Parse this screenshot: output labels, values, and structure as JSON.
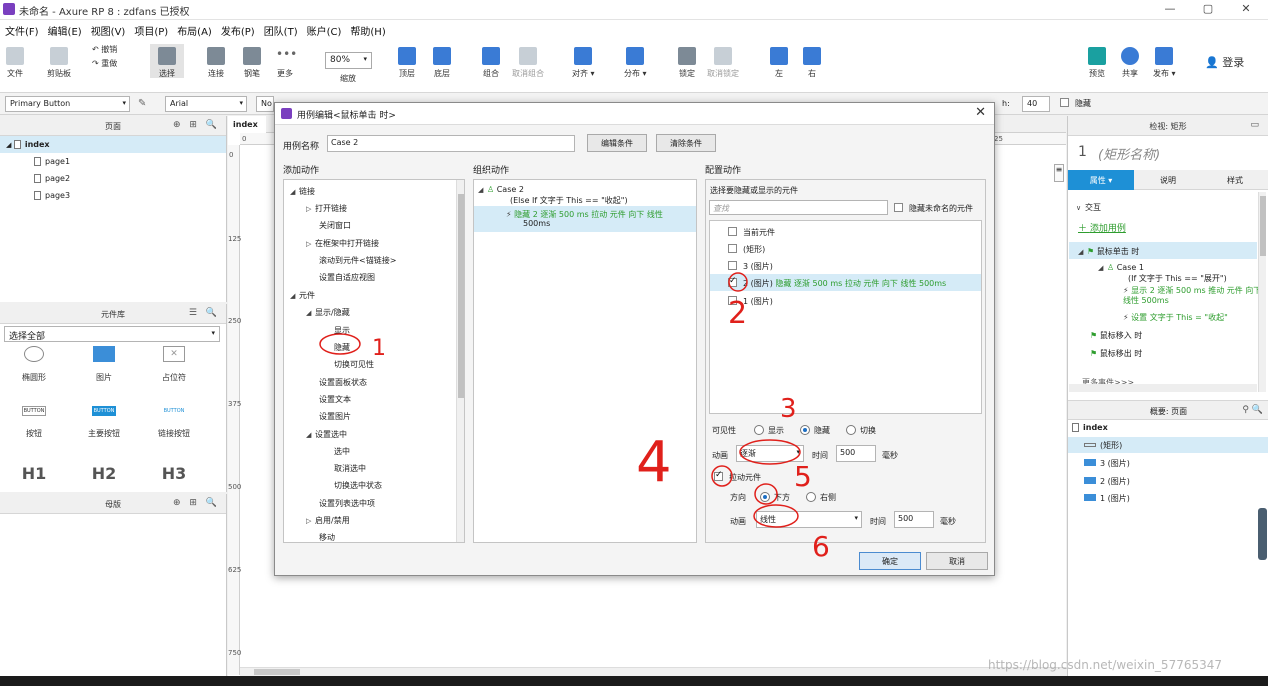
{
  "window": {
    "title": "未命名 - Axure RP 8 : zdfans 已授权"
  },
  "menu": [
    "文件(F)",
    "编辑(E)",
    "视图(V)",
    "项目(P)",
    "布局(A)",
    "发布(P)",
    "团队(T)",
    "账户(C)",
    "帮助(H)"
  ],
  "toolbar": {
    "file": "文件",
    "clipboard": "剪贴板",
    "undo": "撤销",
    "redo": "重做",
    "select": "选择",
    "connect": "连接",
    "pen": "钢笔",
    "more": "更多",
    "zoom_value": "80%",
    "zoom_label": "缩放",
    "top": "顶层",
    "bottom": "底层",
    "group": "组合",
    "ungroup": "取消组合",
    "align": "对齐",
    "distribute": "分布",
    "lock": "锁定",
    "unlock": "取消锁定",
    "left": "左",
    "right": "右",
    "preview": "预览",
    "share": "共享",
    "publish": "发布",
    "login": "登录"
  },
  "format": {
    "style": "Primary Button",
    "font": "Arial",
    "font_style": "No",
    "h_label": "h:",
    "h_value": "40",
    "hidden_label": "隐藏"
  },
  "pages_panel": {
    "title": "页面",
    "items": [
      "index",
      "page1",
      "page2",
      "page3"
    ]
  },
  "library_panel": {
    "title": "元件库",
    "select": "选择全部",
    "widgets": [
      "椭圆形",
      "图片",
      "占位符",
      "按钮",
      "主要按钮",
      "链接按钮",
      "H1",
      "H2",
      "H3"
    ],
    "btn_texts": [
      "BUTTON",
      "BUTTON",
      "BUTTON"
    ]
  },
  "masters_panel": {
    "title": "母版"
  },
  "canvas": {
    "tab": "index",
    "ruler_top": [
      "0",
      "25"
    ],
    "ruler_left": [
      "0",
      "125",
      "250",
      "375",
      "500",
      "625",
      "750"
    ]
  },
  "inspector": {
    "header": "检视: 矩形",
    "number": "1",
    "name": "(矩形名称)",
    "tabs": [
      "属性",
      "说明",
      "样式"
    ],
    "interaction": "交互",
    "add_case": "添加用例",
    "events": [
      {
        "label": "鼠标单击 时"
      },
      {
        "label": "Case 1"
      },
      {
        "label": "(If 文字于 This == \"展开\")"
      },
      {
        "label": "显示 2 逐渐 500 ms 推动 元件 向下 线性 500ms"
      },
      {
        "label": "设置 文字于 This = \"收起\""
      },
      {
        "label": "鼠标移入 时"
      },
      {
        "label": "鼠标移出 时"
      }
    ],
    "more_events": "更多事件>>>"
  },
  "outline": {
    "title": "概要: 页面",
    "items": [
      "index",
      "(矩形)",
      "3 (图片)",
      "2 (图片)",
      "1 (图片)"
    ]
  },
  "dialog": {
    "title": "用例编辑<鼠标单击 时>",
    "case_name_label": "用例名称",
    "case_name_value": "Case 2",
    "edit_condition": "编辑条件",
    "clear_condition": "清除条件",
    "add_action_title": "添加动作",
    "organize_title": "组织动作",
    "configure_title": "配置动作",
    "actions_tree": [
      "链接",
      "打开链接",
      "关闭窗口",
      "在框架中打开链接",
      "滚动到元件<锚链接>",
      "设置自适应视图",
      "元件",
      "显示/隐藏",
      "显示",
      "隐藏",
      "切换可见性",
      "设置面板状态",
      "设置文本",
      "设置图片",
      "设置选中",
      "选中",
      "取消选中",
      "切换选中状态",
      "设置列表选中项",
      "启用/禁用",
      "移动"
    ],
    "organize": {
      "case": "Case 2",
      "condition": "(Else If 文字于 This == \"收起\")",
      "action": "隐藏 2 逐渐 500 ms 拉动 元件 向下 线性",
      "action2": "500ms"
    },
    "configure": {
      "select_label": "选择要隐藏或显示的元件",
      "search_placeholder": "查找",
      "hide_unnamed": "隐藏未命名的元件",
      "widgets": [
        "当前元件",
        "(矩形)",
        "3 (图片)",
        "2 (图片)",
        "1 (图片)"
      ],
      "widget2_detail": "隐藏 逐渐 500 ms 拉动 元件 向下 线性 500ms",
      "visibility_label": "可见性",
      "show": "显示",
      "hide": "隐藏",
      "toggle": "切换",
      "animate_label": "动画",
      "animate_value": "逐渐",
      "time_label": "时间",
      "time_value": "500",
      "ms": "毫秒",
      "pull_label": "拉动元件",
      "direction_label": "方向",
      "down": "下方",
      "right": "右侧",
      "animate2_label": "动画",
      "animate2_value": "线性",
      "time2_label": "时间",
      "time2_value": "500",
      "ms2": "毫秒"
    },
    "ok": "确定",
    "cancel": "取消"
  },
  "annotations": [
    "1",
    "2",
    "3",
    "4",
    "5",
    "6"
  ],
  "watermark": "https://blog.csdn.net/weixin_57765347"
}
